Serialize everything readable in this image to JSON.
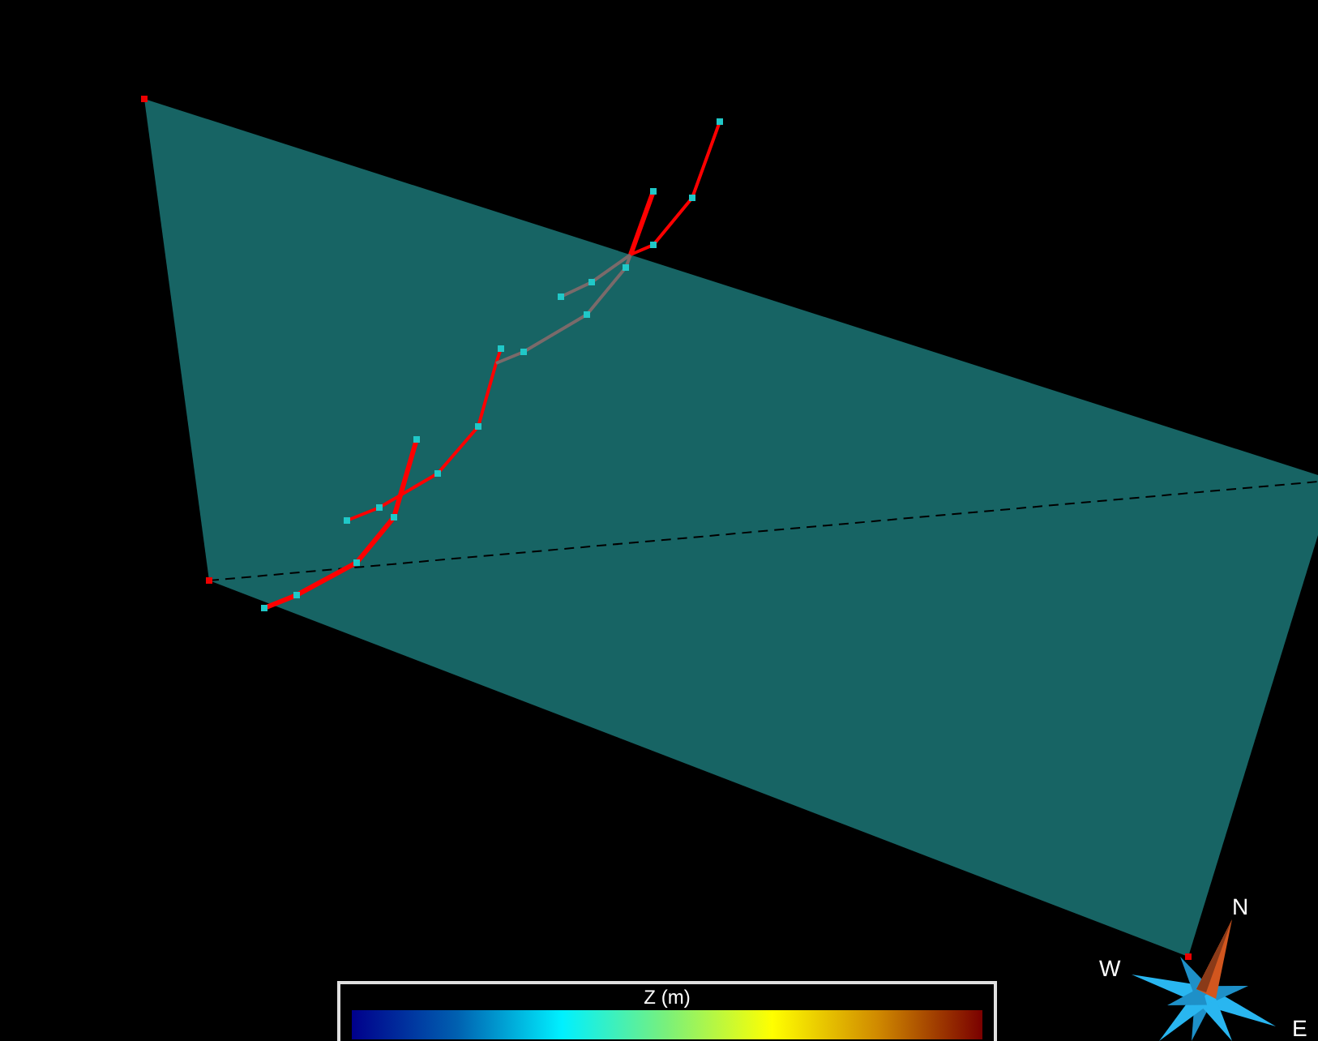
{
  "colorbar": {
    "title": "Z (m)"
  },
  "compass": {
    "north": "N",
    "west": "W",
    "east": "E"
  }
}
